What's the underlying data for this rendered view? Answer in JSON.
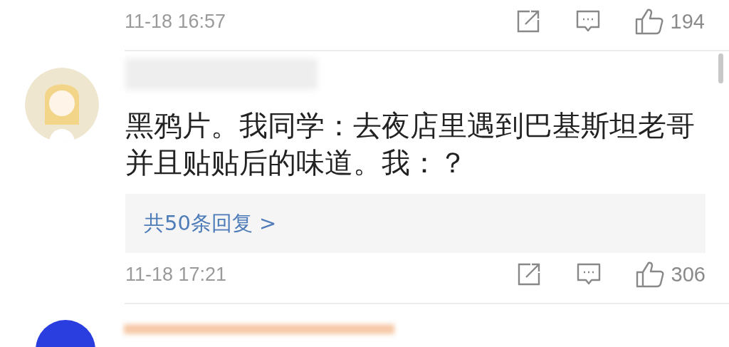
{
  "previous_footer": {
    "time": "11-18 16:57",
    "likes": "194"
  },
  "comment": {
    "text": "黑鸦片。我同学：去夜店里遇到巴基斯坦老哥并且贴贴后的味道。我：？",
    "replies_link": "共50条回复 >",
    "time": "11-18 17:21",
    "likes": "306"
  }
}
